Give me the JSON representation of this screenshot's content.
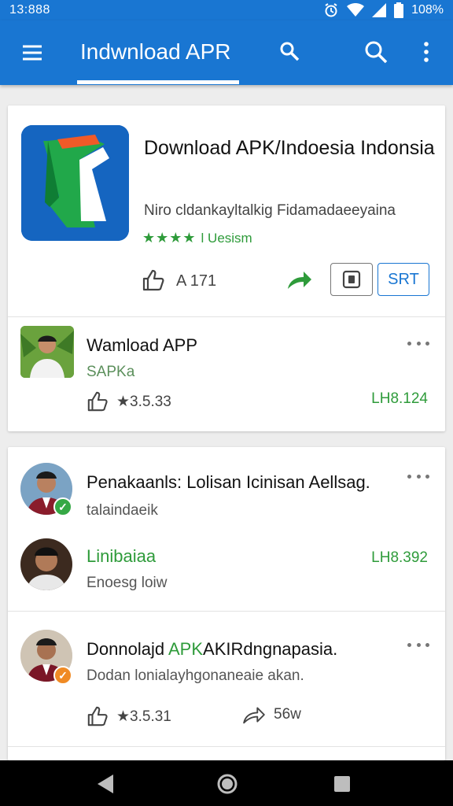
{
  "status_bar": {
    "time": "13:888",
    "battery": "108%"
  },
  "app_bar": {
    "title": "Indwnload APR"
  },
  "featured": {
    "name": "Download APK/Indoesia Indonsia",
    "description": "Niro cldankayltalkig Fidamadaeeyaina",
    "stars": "★★★★",
    "rating_label": "l Uesism",
    "likes": "A 171",
    "install_label": "SRT"
  },
  "related": {
    "title": "Wamload APP",
    "subtitle": "SAPKa",
    "rating": "★3.5.33",
    "version": "LH8.124"
  },
  "posts": [
    {
      "title": "Penakaanls: Lolisan Icinisan Aellsag.",
      "subtitle": "talaindaeik"
    },
    {
      "title": "Linibaiaa",
      "subtitle": "Enoesg loiw",
      "version": "LH8.392"
    },
    {
      "title_prefix": "Donnolajd ",
      "title_highlight": "APK",
      "title_suffix": "AKIRdngnapasia.",
      "subtitle": "Dodan lonialayhgonaneaie akan.",
      "rating": "★3.5.31",
      "shares": "56w"
    }
  ],
  "colors": {
    "primary": "#1976d2",
    "accent_green": "#2e9b3a",
    "badge_orange": "#f08a24"
  }
}
